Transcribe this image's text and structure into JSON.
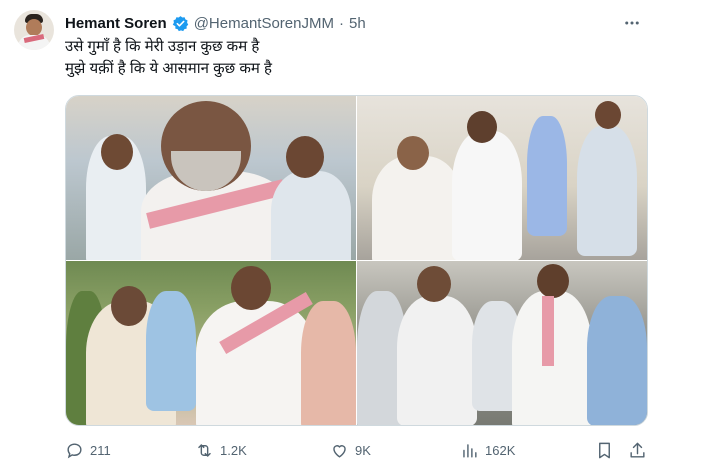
{
  "tweet": {
    "author_name": "Hemant Soren",
    "handle": "@HemantSorenJMM",
    "separator": "·",
    "time": "5h",
    "more_icon": "more-horizontal-icon",
    "lines": [
      "उसे गुमाँ है कि मेरी उड़ान कुछ कम है",
      "मुझे यक़ीं है कि ये आसमान कुछ कम है"
    ],
    "media_count": 4
  },
  "actions": {
    "replies": "211",
    "reposts": "1.2K",
    "likes": "9K",
    "views": "162K"
  },
  "colors": {
    "verified": "#1d9bf0",
    "muted": "#536471",
    "text": "#0f1419"
  }
}
